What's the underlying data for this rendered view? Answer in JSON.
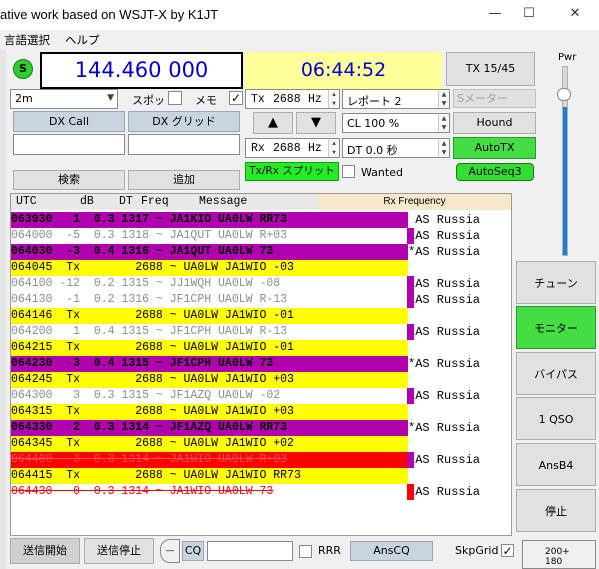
{
  "window": {
    "title": "ative work based on WSJT-X by K1JT",
    "minimize": "—",
    "maximize": "☐",
    "close": "✕"
  },
  "menu": {
    "items": [
      "言語選択",
      "ヘルプ"
    ]
  },
  "status": {
    "indicator": "S"
  },
  "frequency": "144.460 000",
  "clock": "06:44:52",
  "tx_button": "TX 15/45",
  "band": {
    "value": "2m"
  },
  "spot": {
    "label": "スポット",
    "checked": false
  },
  "memo": {
    "label": "メモ",
    "checked": true
  },
  "tx_hz": {
    "prefix": "Tx",
    "value": "2688",
    "unit": "Hz"
  },
  "report": "レポート 2",
  "smeter": "Sメーター",
  "dx_call": {
    "label": "DX Call",
    "value": ""
  },
  "dx_grid": {
    "label": "DX グリッド",
    "value": ""
  },
  "arrows": {
    "up": "▲",
    "down": "▼"
  },
  "cl": "CL  100 %",
  "hound": "Hound",
  "rx_hz": {
    "prefix": "Rx",
    "value": "2688",
    "unit": "Hz"
  },
  "dt": "DT 0.0 秒",
  "auto_tx": "AutoTX",
  "auto_seq": "AutoSeq3",
  "search": "検索",
  "add": "追加",
  "split": "Tx/Rx スプリット",
  "wanted": {
    "label": "Wanted",
    "checked": false
  },
  "pwr": "Pwr",
  "decoded": {
    "headers": {
      "utc": "UTC",
      "db": "dB",
      "dt": "DT",
      "freq": "Freq",
      "message": "Message",
      "rx_frequency": "Rx Frequency"
    },
    "rows": [
      {
        "text": "063930   1  0.3 1317 ~ JA1KIO UA0LW RR73",
        "bg": "#b000b0",
        "fg": "#000000",
        "bold": true,
        "strike": false,
        "marker": "",
        "bar": "",
        "country": "AS Russia"
      },
      {
        "text": "064000  -5  0.3 1318 ~ JA1QUT UA0LW R+03",
        "bg": "#ffffff",
        "fg": "#8c8c8c",
        "bold": false,
        "strike": false,
        "marker": "",
        "bar": "#b000b0",
        "country": "AS Russia"
      },
      {
        "text": "064030  -3  0.4 1316 ~ JA1QUT UA0LW 73",
        "bg": "#b000b0",
        "fg": "#000000",
        "bold": true,
        "strike": false,
        "marker": "*",
        "bar": "",
        "country": "AS Russia"
      },
      {
        "text": "064045  Tx        2688 ~ UA0LW JA1WIO -03",
        "bg": "#ffff00",
        "fg": "#000000",
        "bold": false,
        "strike": false,
        "marker": "",
        "bar": "",
        "country": ""
      },
      {
        "text": "064100 -12  0.2 1315 ~ JJ1WQH UA0LW -08",
        "bg": "#ffffff",
        "fg": "#8c8c8c",
        "bold": false,
        "strike": false,
        "marker": "",
        "bar": "#b000b0",
        "country": "AS Russia"
      },
      {
        "text": "064130  -1  0.2 1316 ~ JF1CPH UA0LW R-13",
        "bg": "#ffffff",
        "fg": "#8c8c8c",
        "bold": false,
        "strike": false,
        "marker": "",
        "bar": "#b000b0",
        "country": "AS Russia"
      },
      {
        "text": "064146  Tx        2688 ~ UA0LW JA1WIO -01",
        "bg": "#ffff00",
        "fg": "#000000",
        "bold": false,
        "strike": false,
        "marker": "",
        "bar": "",
        "country": ""
      },
      {
        "text": "064200   1  0.4 1315 ~ JF1CPH UA0LW R-13",
        "bg": "#ffffff",
        "fg": "#8c8c8c",
        "bold": false,
        "strike": false,
        "marker": "",
        "bar": "#b000b0",
        "country": "AS Russia"
      },
      {
        "text": "064215  Tx        2688 ~ UA0LW JA1WIO -01",
        "bg": "#ffff00",
        "fg": "#000000",
        "bold": false,
        "strike": false,
        "marker": "",
        "bar": "",
        "country": ""
      },
      {
        "text": "064230   3  0.4 1315 ~ JF1CPH UA0LW 73",
        "bg": "#b000b0",
        "fg": "#000000",
        "bold": true,
        "strike": false,
        "marker": "*",
        "bar": "",
        "country": "AS Russia"
      },
      {
        "text": "064245  Tx        2688 ~ UA0LW JA1WIO +03",
        "bg": "#ffff00",
        "fg": "#000000",
        "bold": false,
        "strike": false,
        "marker": "",
        "bar": "",
        "country": ""
      },
      {
        "text": "064300   3  0.3 1315 ~ JF1AZQ UA0LW -02",
        "bg": "#ffffff",
        "fg": "#8c8c8c",
        "bold": false,
        "strike": false,
        "marker": "",
        "bar": "#b000b0",
        "country": "AS Russia"
      },
      {
        "text": "064315  Tx        2688 ~ UA0LW JA1WIO +03",
        "bg": "#ffff00",
        "fg": "#000000",
        "bold": false,
        "strike": false,
        "marker": "",
        "bar": "",
        "country": ""
      },
      {
        "text": "064330   2  0.3 1314 ~ JF1AZQ UA0LW RR73",
        "bg": "#b000b0",
        "fg": "#000000",
        "bold": true,
        "strike": false,
        "marker": "*",
        "bar": "",
        "country": "AS Russia"
      },
      {
        "text": "064345  Tx        2688 ~ UA0LW JA1WIO +02",
        "bg": "#ffff00",
        "fg": "#000000",
        "bold": false,
        "strike": false,
        "marker": "",
        "bar": "",
        "country": ""
      },
      {
        "text": "064400   3  0.3 1314 ~ JA1WIO UA0LW R+03",
        "bg": "#ff0000",
        "fg": "#ff5050",
        "bold": false,
        "strike": true,
        "marker": "",
        "bar": "#b000b0",
        "country": "AS Russia"
      },
      {
        "text": "064415  Tx        2688 ~ UA0LW JA1WIO RR73",
        "bg": "#ffff00",
        "fg": "#000000",
        "bold": false,
        "strike": false,
        "marker": "",
        "bar": "",
        "country": ""
      },
      {
        "text": "064430   0  0.3 1314 ~ JA1WIO UA0LW 73",
        "bg": "#ffffff",
        "fg": "#ff0000",
        "bold": false,
        "strike": true,
        "marker": "",
        "bar": "#ff0000",
        "country": "AS Russia"
      }
    ]
  },
  "right_buttons": {
    "tune": "チューン",
    "monitor": "モニター",
    "bypass": "バイパス",
    "one_qso": "1 QSO",
    "ansb4": "AnsB4",
    "stop": "停止"
  },
  "bottom": {
    "send_start": "送信開始",
    "send_stop": "送信停止",
    "dash": "—",
    "cq": "CQ",
    "rrr": "RRR",
    "ans_cq": "AnsCQ",
    "skpgrid": {
      "label": "SkpGrid",
      "checked": true
    },
    "corner": "200+\n180"
  },
  "colors": {
    "accent_green": "#44dd44",
    "freq_blue": "#0000cc",
    "clock_bg": "#ffff99",
    "purple": "#b000b0",
    "tx_yellow": "#ffff00"
  }
}
